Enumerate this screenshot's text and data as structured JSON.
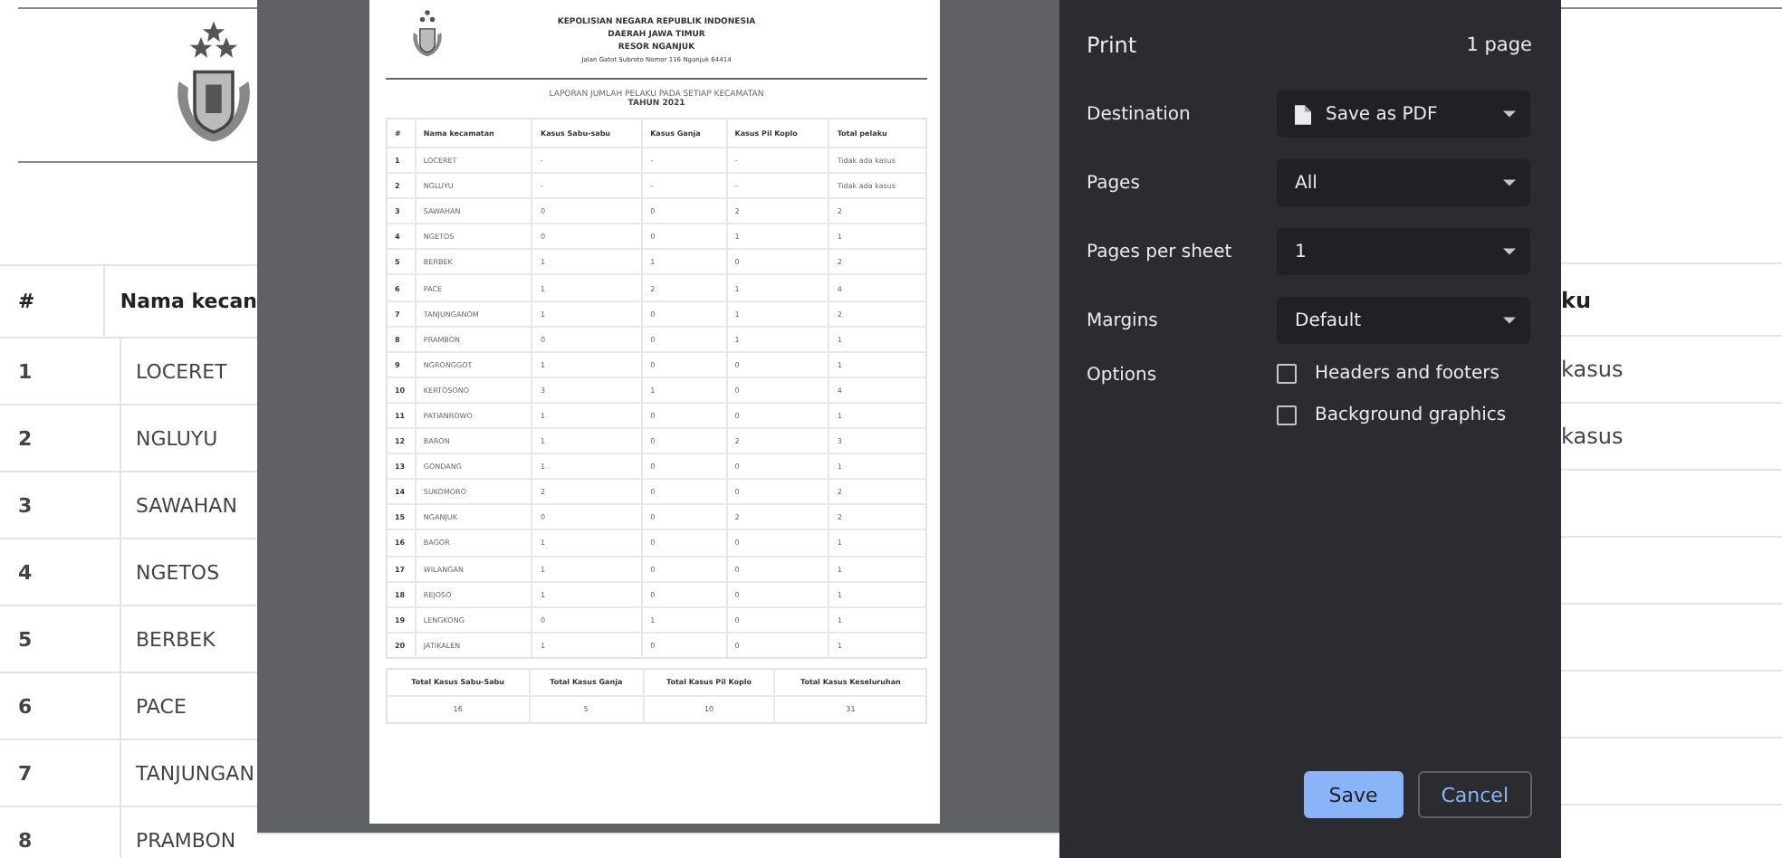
{
  "background_page": {
    "columns": [
      "#",
      "Nama kecan"
    ],
    "right_header": "ku",
    "rows": [
      {
        "number": "1",
        "name": "LOCERET",
        "right": "kasus"
      },
      {
        "number": "2",
        "name": "NGLUYU",
        "right": "kasus"
      },
      {
        "number": "3",
        "name": "SAWAHAN"
      },
      {
        "number": "4",
        "name": "NGETOS"
      },
      {
        "number": "5",
        "name": "BERBEK"
      },
      {
        "number": "6",
        "name": "PACE"
      },
      {
        "number": "7",
        "name": "TANJUNGAN"
      },
      {
        "number": "8",
        "name": "PRAMBON"
      }
    ]
  },
  "preview": {
    "header_lines": [
      "KEPOLISIAN NEGARA REPUBLIK INDONESIA",
      "DAERAH JAWA TIMUR",
      "RESOR NGANJUK",
      "Jalan Gatot Subroto Nomor 116 Nganjuk 64414"
    ],
    "report_title": "LAPORAN JUMLAH PELAKU PADA SETIAP KECAMATAN",
    "report_year": "TAHUN 2021",
    "columns": [
      "#",
      "Nama kecamatan",
      "Kasus Sabu-sabu",
      "Kasus Ganja",
      "Kasus Pil Koplo",
      "Total pelaku"
    ],
    "rows": [
      [
        "1",
        "LOCERET",
        "-",
        "-",
        "-",
        "Tidak ada kasus"
      ],
      [
        "2",
        "NGLUYU",
        "-",
        "-",
        "-",
        "Tidak ada kasus"
      ],
      [
        "3",
        "SAWAHAN",
        "0",
        "0",
        "2",
        "2"
      ],
      [
        "4",
        "NGETOS",
        "0",
        "0",
        "1",
        "1"
      ],
      [
        "5",
        "BERBEK",
        "1",
        "1",
        "0",
        "2"
      ],
      [
        "6",
        "PACE",
        "1",
        "2",
        "1",
        "4"
      ],
      [
        "7",
        "TANJUNGANOM",
        "1",
        "0",
        "1",
        "2"
      ],
      [
        "8",
        "PRAMBON",
        "0",
        "0",
        "1",
        "1"
      ],
      [
        "9",
        "NGRONGGOT",
        "1",
        "0",
        "0",
        "1"
      ],
      [
        "10",
        "KERTOSONO",
        "3",
        "1",
        "0",
        "4"
      ],
      [
        "11",
        "PATIANROWO",
        "1",
        "0",
        "0",
        "1"
      ],
      [
        "12",
        "BARON",
        "1",
        "0",
        "2",
        "3"
      ],
      [
        "13",
        "GONDANG",
        "1",
        "0",
        "0",
        "1"
      ],
      [
        "14",
        "SUKOMORO",
        "2",
        "0",
        "0",
        "2"
      ],
      [
        "15",
        "NGANJUK",
        "0",
        "0",
        "2",
        "2"
      ],
      [
        "16",
        "BAGOR",
        "1",
        "0",
        "0",
        "1"
      ],
      [
        "17",
        "WILANGAN",
        "1",
        "0",
        "0",
        "1"
      ],
      [
        "18",
        "REJOSO",
        "1",
        "0",
        "0",
        "1"
      ],
      [
        "19",
        "LENGKONG",
        "0",
        "1",
        "0",
        "1"
      ],
      [
        "20",
        "JATIKALEN",
        "1",
        "0",
        "0",
        "1"
      ]
    ],
    "totals": {
      "columns": [
        "Total Kasus Sabu-Sabu",
        "Total Kasus Ganja",
        "Total Kasus Pil Koplo",
        "Total Kasus Keseluruhan"
      ],
      "values": [
        "16",
        "5",
        "10",
        "31"
      ]
    }
  },
  "print_panel": {
    "title": "Print",
    "page_count": "1 page",
    "settings": [
      {
        "label": "Destination",
        "kind": "destination",
        "value": "Save as PDF"
      },
      {
        "label": "Pages",
        "kind": "select",
        "value": "All"
      },
      {
        "label": "Pages per sheet",
        "kind": "select",
        "value": "1"
      },
      {
        "label": "Margins",
        "kind": "select",
        "value": "Default"
      },
      {
        "label": "Options",
        "kind": "checkboxes",
        "options": [
          {
            "label": "Headers and footers",
            "checked": false
          },
          {
            "label": "Background graphics",
            "checked": false
          }
        ]
      }
    ],
    "buttons": [
      {
        "label": "Save",
        "primary": true
      },
      {
        "label": "Cancel",
        "primary": false
      }
    ]
  }
}
